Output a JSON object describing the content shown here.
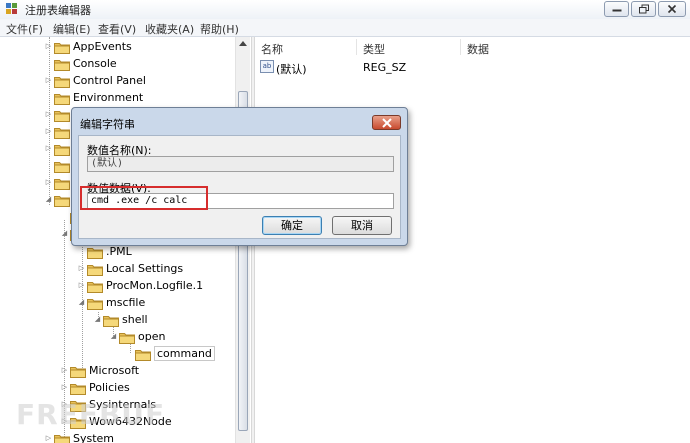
{
  "window": {
    "title": "注册表编辑器"
  },
  "menu": [
    "文件(F)",
    "编辑(E)",
    "查看(V)",
    "收藏夹(A)",
    "帮助(H)"
  ],
  "tree": {
    "nodes": [
      {
        "label": "AppEvents"
      },
      {
        "label": "Console"
      },
      {
        "label": "Control Panel"
      },
      {
        "label": "Environment"
      },
      {
        "label": ".PML"
      },
      {
        "label": "Local Settings"
      },
      {
        "label": "ProcMon.Logfile.1"
      },
      {
        "label": "mscfile"
      },
      {
        "label": "shell"
      },
      {
        "label": "open"
      },
      {
        "label": "command"
      },
      {
        "label": "Microsoft"
      },
      {
        "label": "Policies"
      },
      {
        "label": "Sysinternals"
      },
      {
        "label": "Wow6432Node"
      },
      {
        "label": "System"
      }
    ]
  },
  "list": {
    "columns": [
      "名称",
      "类型",
      "数据"
    ],
    "rows": [
      {
        "name": "(默认)",
        "type": "REG_SZ",
        "data": ""
      }
    ]
  },
  "dialog": {
    "title": "编辑字符串",
    "name_label": "数值名称(N):",
    "name_value": "(默认)",
    "data_label": "数值数据(V):",
    "data_value": "cmd .exe /c calc",
    "ok_label": "确定",
    "cancel_label": "取消"
  },
  "watermark": "FREEBUF",
  "colors": {
    "highlight": "#d62d2d",
    "dialog_frame": "#cad8ea"
  }
}
